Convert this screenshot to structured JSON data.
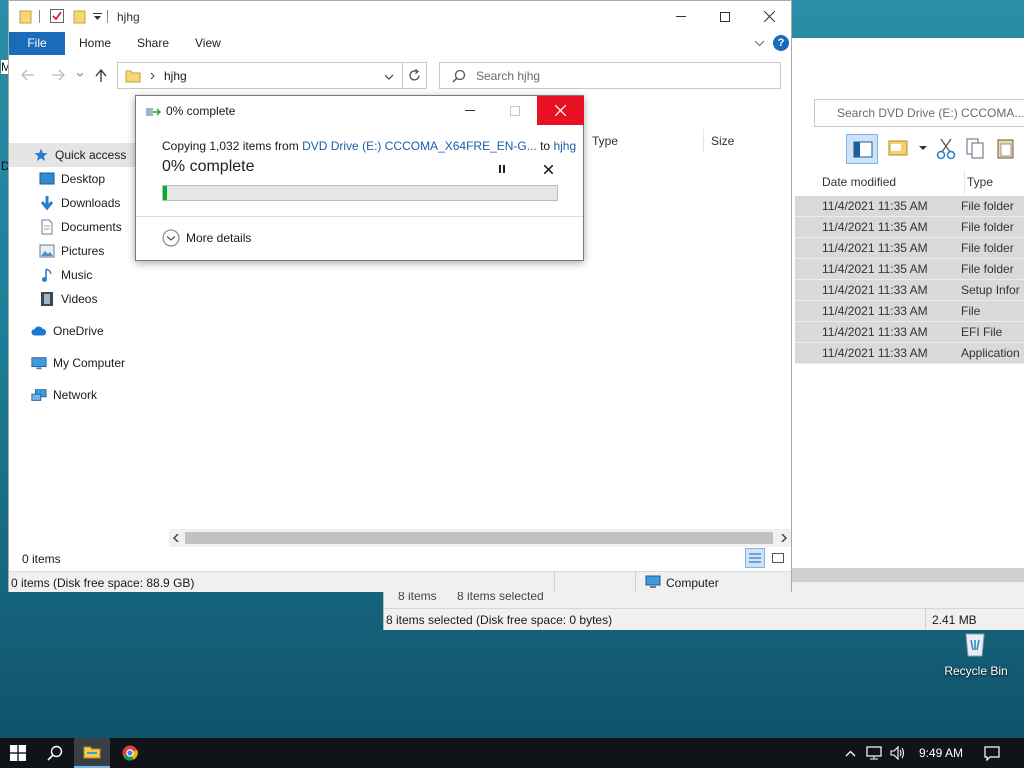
{
  "back_window": {
    "search_placeholder": "Search DVD Drive (E:) CCCOMA...",
    "columns": {
      "date": "Date modified",
      "type": "Type"
    },
    "rows": [
      {
        "date": "11/4/2021 11:35 AM",
        "type": "File folder"
      },
      {
        "date": "11/4/2021 11:35 AM",
        "type": "File folder"
      },
      {
        "date": "11/4/2021 11:35 AM",
        "type": "File folder"
      },
      {
        "date": "11/4/2021 11:35 AM",
        "type": "File folder"
      },
      {
        "date": "11/4/2021 11:33 AM",
        "type": "Setup Infor"
      },
      {
        "date": "11/4/2021 11:33 AM",
        "type": "File"
      },
      {
        "date": "11/4/2021 11:33 AM",
        "type": "EFI File"
      },
      {
        "date": "11/4/2021 11:33 AM",
        "type": "Application"
      }
    ],
    "status_items": "8 items",
    "status_selected": "8 items selected",
    "bottom_status": "8 items selected (Disk free space: 0 bytes)",
    "bottom_size": "2.41 MB",
    "left_letter_m": "M",
    "left_letter_d": "D"
  },
  "front_window": {
    "title": "hjhg",
    "tabs": {
      "file": "File",
      "home": "Home",
      "share": "Share",
      "view": "View"
    },
    "address_crumb": "hjhg",
    "search_placeholder": "Search hjhg",
    "columns": {
      "type": "Type",
      "size": "Size"
    },
    "nav": {
      "quick_access": "Quick access",
      "desktop": "Desktop",
      "downloads": "Downloads",
      "documents": "Documents",
      "pictures": "Pictures",
      "music": "Music",
      "videos": "Videos",
      "onedrive": "OneDrive",
      "my_computer": "My Computer",
      "network": "Network"
    },
    "item_count": "0 items",
    "status_text": "0 items (Disk free space: 88.9 GB)",
    "status_location": "Computer"
  },
  "copy_dialog": {
    "title": "0% complete",
    "copy_prefix": "Copying 1,032 items from ",
    "source": "DVD Drive (E:) CCCOMA_X64FRE_EN-G...",
    "to_word": " to ",
    "destination": "hjhg",
    "progress_text": "0% complete",
    "progress_fraction": 0.01,
    "more_details": "More details"
  },
  "desktop": {
    "recycle_bin": "Recycle Bin"
  },
  "taskbar": {
    "time": "9:49 AM"
  },
  "colors": {
    "accent": "#1a6bb8",
    "close_red": "#e81123",
    "progress_green": "#06b025",
    "selection_gray": "#d9d9d9"
  }
}
